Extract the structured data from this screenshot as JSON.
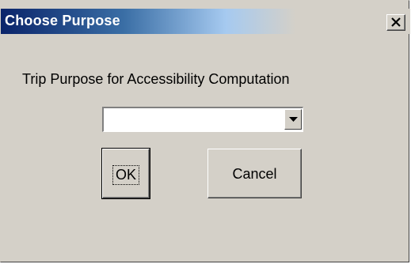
{
  "window": {
    "title": "Choose Purpose",
    "close_symbol": "close-icon"
  },
  "dialog": {
    "prompt": "Trip Purpose for Accessibility Computation",
    "purpose_select": {
      "selected_value": "",
      "options_visible": []
    },
    "ok_label": "OK",
    "cancel_label": "Cancel"
  },
  "colors": {
    "titlebar_start": "#0a246a",
    "titlebar_end": "#d4d0c8",
    "face": "#d4d0c8"
  }
}
